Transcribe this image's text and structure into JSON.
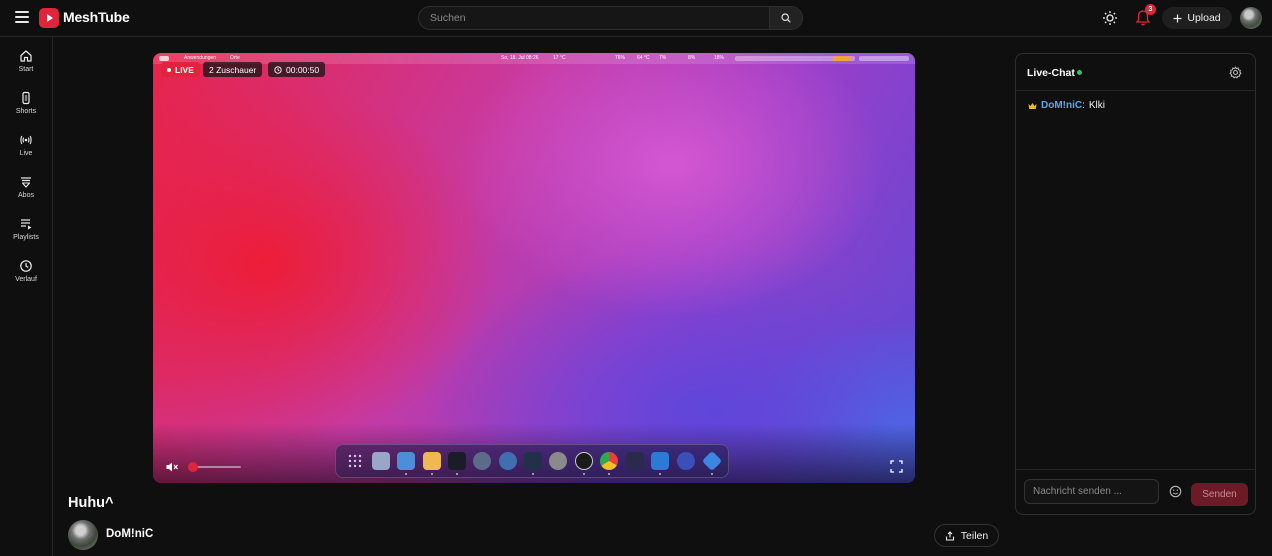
{
  "header": {
    "menu_icon": "hamburger-icon",
    "brand": "MeshTube",
    "search_placeholder": "Suchen",
    "search_icon": "search-icon",
    "theme_icon": "sun-icon",
    "bell_icon": "bell-icon",
    "notification_count": "3",
    "upload_label": "Upload",
    "accent_color": "#e0243c"
  },
  "sidebar": {
    "items": [
      {
        "label": "Start",
        "icon": "home-icon"
      },
      {
        "label": "Shorts",
        "icon": "shorts-icon"
      },
      {
        "label": "Live",
        "icon": "live-broadcast-icon"
      },
      {
        "label": "Abos",
        "icon": "subscriptions-icon"
      },
      {
        "label": "Playlists",
        "icon": "playlist-icon"
      },
      {
        "label": "Verlauf",
        "icon": "history-icon"
      }
    ]
  },
  "player": {
    "live_label": "LIVE",
    "viewers": "2 Zuschauer",
    "elapsed": "00:00:50",
    "muted": true,
    "volume": 0.0,
    "screen_menubar": {
      "left": [
        "Anwendungen",
        "Orte"
      ],
      "date": "So, 18. Jul  08:26",
      "temp": "17 °C",
      "battery": "76%",
      "cpu_temp": "64 °C",
      "fan": "7%",
      "disk": "8%",
      "mem": "18%"
    }
  },
  "video": {
    "title": "Huhu^",
    "channel_name": "DoM!niC",
    "share_label": "Teilen"
  },
  "chat": {
    "title": "Live-Chat",
    "online_color": "#2fc46a",
    "messages": [
      {
        "badge": "crown-icon",
        "user": "DoM!niC",
        "separator": ":",
        "text": "Klki"
      }
    ],
    "input_placeholder": "Nachricht senden ...",
    "send_label": "Senden"
  }
}
